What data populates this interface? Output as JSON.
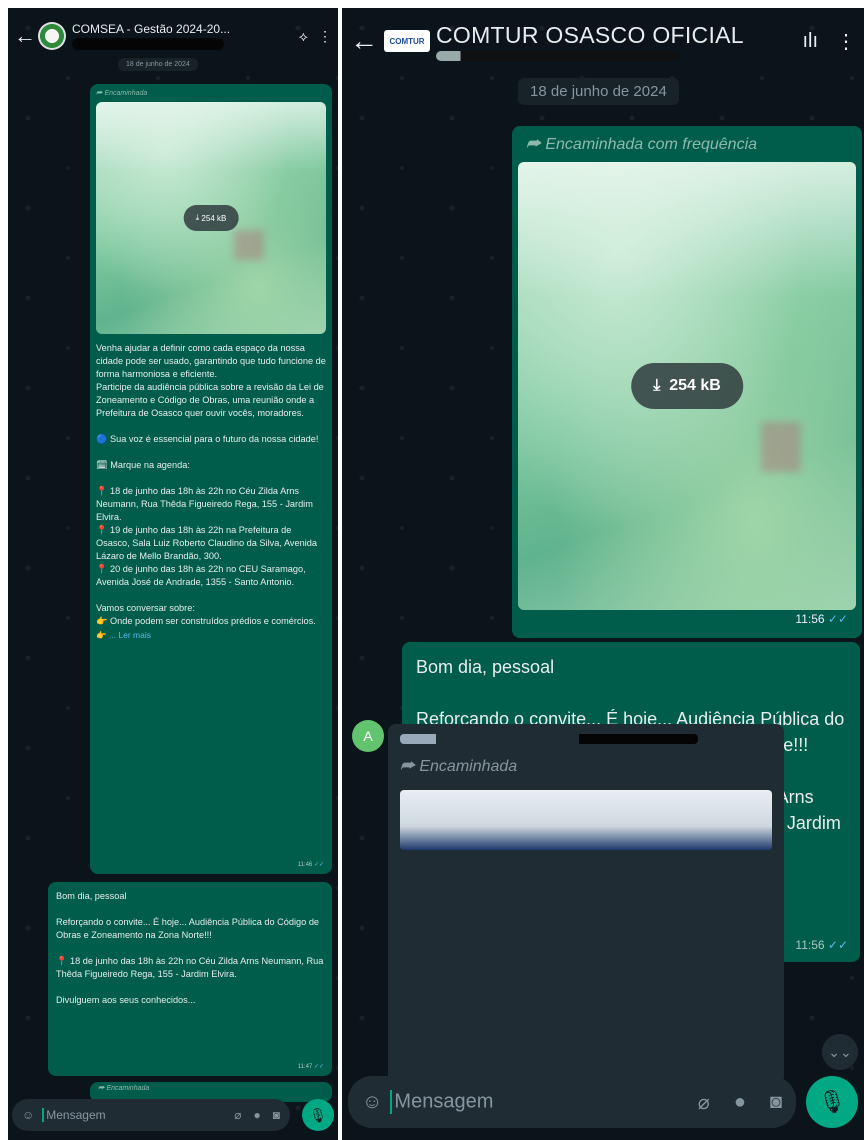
{
  "left": {
    "header": {
      "title": "COMSEA - Gestão 2024-20...",
      "back_icon": "←",
      "mic_icon": "⟡",
      "menu_icon": "⋮"
    },
    "date_chip": "18 de junho de 2024",
    "bubble1": {
      "forwarded": "Encaminhada",
      "media_size": "254 kB",
      "text": "Venha ajudar a definir como cada espaço da nossa cidade pode ser usado, garantindo que tudo funcione de forma harmoniosa e eficiente.\nParticipe da audiência pública sobre a revisão da Lei de Zoneamento e Código de Obras, uma reunião onde a Prefeitura de Osasco quer ouvir vocês, moradores.\n\n🔵 Sua voz é essencial para o futuro da nossa cidade!\n\n🗓 Marque na agenda:\n\n📍 18 de junho das 18h às 22h no Céu Zilda Arns Neumann, Rua Thêda Figueiredo Rega, 155 - Jardim Elvira.\n📍 19 de junho das 18h às 22h na Prefeitura de Osasco, Sala Luiz Roberto Claudino da Silva, Avenida Lázaro de Mello Brandão, 300.\n📍 20 de junho das 18h às 22h no CEU Saramago, Avenida José de Andrade, 1355 - Santo Antonio.\n\nVamos conversar sobre:\n👉 Onde podem ser construídos prédios e comércios.",
      "read_more": "👉 ... Ler mais",
      "time": "11:46"
    },
    "bubble2": {
      "text": "Bom dia, pessoal\n\nReforçando o convite... É hoje... Audiência Pública do Código de Obras e Zoneamento na Zona Norte!!!\n\n📍 18 de junho das 18h às 22h no Céu Zilda Arns Neumann, Rua Thêda Figueiredo Rega, 155 - Jardim Elvira.\n\nDivulguem aos seus conhecidos...",
      "time": "11:47"
    },
    "bubble3_forwarded": "Encaminhada",
    "composer": {
      "placeholder": "Mensagem"
    }
  },
  "right": {
    "header": {
      "title": "COMTUR OSASCO OFICIAL",
      "logo_text": "COMTUR",
      "back_icon": "←",
      "mic_icon": "ılı",
      "menu_icon": "⋮"
    },
    "date_chip": "18 de junho de 2024",
    "bubble1": {
      "forwarded": "Encaminhada com frequência",
      "media_size": "254 kB",
      "time": "11:56"
    },
    "bubble2": {
      "text": "Bom dia, pessoal\n\nReforçando o convite... É hoje... Audiência Pública do Código de Obras e Zoneamento na Zona Norte!!!\n\n📍 18 de junho das 18h às 22h no Céu Zilda Arns Neumann, Rua Thêda Figueiredo Rega, 155 - Jardim Elvira.\n\nDivulguem aos seus conhecidos...",
      "time": "11:56"
    },
    "incoming": {
      "avatar_letter": "A",
      "forwarded": "Encaminhada"
    },
    "composer": {
      "placeholder": "Mensagem"
    }
  },
  "colors": {
    "chat_bg": "#0b141a",
    "outgoing_bubble": "#005c4b",
    "incoming_bubble": "#202c33",
    "accent": "#00a884",
    "link": "#53bdeb"
  },
  "icons": {
    "emoji": "emoji-icon",
    "attach": "paperclip-icon",
    "payment": "rupee-icon",
    "camera": "camera-icon",
    "mic": "microphone-icon",
    "download": "download-icon",
    "double_check": "double-check-icon",
    "forward": "forward-arrow-icon",
    "scroll_down": "chevron-double-down-icon"
  }
}
